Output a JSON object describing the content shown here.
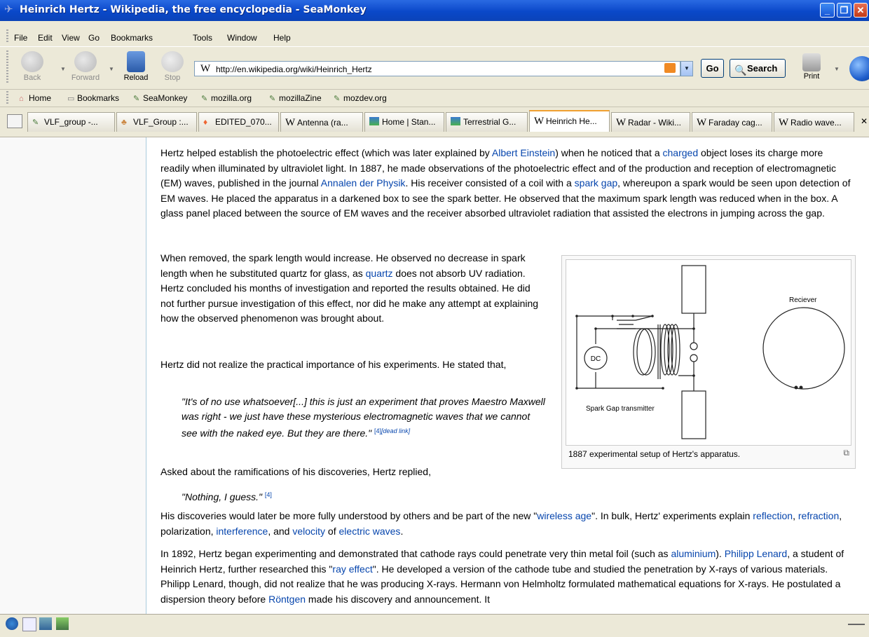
{
  "window": {
    "title": "Heinrich Hertz - Wikipedia, the free encyclopedia - SeaMonkey",
    "min_glyph": "_",
    "max_glyph": "❐",
    "close_glyph": "✕"
  },
  "menu": [
    "File",
    "Edit",
    "View",
    "Go",
    "Bookmarks",
    "Tools",
    "Window",
    "Help"
  ],
  "nav": {
    "back": "Back",
    "forward": "Forward",
    "reload": "Reload",
    "stop": "Stop",
    "url_icon": "W",
    "url": "http://en.wikipedia.org/wiki/Heinrich_Hertz",
    "go": "Go",
    "search": "Search",
    "print": "Print"
  },
  "bookmarks": [
    "Home",
    "Bookmarks",
    "SeaMonkey",
    "mozilla.org",
    "mozillaZine",
    "mozdev.org"
  ],
  "tabs": [
    {
      "label": "VLF_group -...",
      "icon": "pencil-icon"
    },
    {
      "label": "VLF_Group :...",
      "icon": "group-icon"
    },
    {
      "label": "EDITED_070...",
      "icon": "flame-icon"
    },
    {
      "label": "Antenna (ra...",
      "icon": "wikipedia-icon"
    },
    {
      "label": "Home | Stan...",
      "icon": "map-icon"
    },
    {
      "label": "Terrestrial G...",
      "icon": "map-icon"
    },
    {
      "label": "Heinrich He...",
      "icon": "wikipedia-icon",
      "active": true
    },
    {
      "label": "Radar - Wiki...",
      "icon": "wikipedia-icon"
    },
    {
      "label": "Faraday cag...",
      "icon": "wikipedia-icon"
    },
    {
      "label": "Radio wave...",
      "icon": "wikipedia-icon"
    }
  ],
  "article": {
    "p1": {
      "t1": "Hertz helped establish the photoelectric effect (which was later explained by ",
      "l1": "Albert Einstein",
      "t2": ") when he noticed that a ",
      "l2": "charged",
      "t3": " object loses its charge more readily when illuminated by ultraviolet light. In 1887, he made observations of the photoelectric effect and of the production and reception of electromagnetic (EM) waves, published in the journal ",
      "l3": "Annalen der Physik",
      "t4": ". His receiver consisted of a coil with a ",
      "l4": "spark gap",
      "t5": ", whereupon a spark would be seen upon detection of EM waves. He placed the apparatus in a darkened box to see the spark better. He observed that the maximum spark length was reduced when in the box. A glass panel placed between the source of EM waves and the receiver absorbed ultraviolet radiation that assisted the electrons in jumping across the gap."
    },
    "p2": {
      "t1": "When removed, the spark length would increase. He observed no decrease in spark length when he substituted quartz for glass, as ",
      "l1": "quartz",
      "t2": " does not absorb UV radiation. Hertz concluded his months of investigation and reported the results obtained. He did not further pursue investigation of this effect, nor did he make any attempt at explaining how the observed phenomenon was brought about."
    },
    "p3": "Hertz did not realize the practical importance of his experiments. He stated that,",
    "quote1": {
      "text": "\"It's of no use whatsoever[...] this is just an experiment that proves Maestro Maxwell was right - we just have these mysterious electromagnetic waves that we cannot see with the naked eye. But they are there.\"",
      "ref": "[4]",
      "dead": "[dead link]"
    },
    "p4": "Asked about the ramifications of his discoveries, Hertz replied,",
    "quote2": {
      "text": "\"Nothing, I guess.\"",
      "ref": "[4]"
    },
    "p5": {
      "t1": "His discoveries would later be more fully understood by others and be part of the new \"",
      "l1": "wireless age",
      "t2": "\". In bulk, Hertz' experiments explain ",
      "l2": "reflection",
      "t3": ", ",
      "l3": "refraction",
      "t4": ", polarization, ",
      "l4": "interference",
      "t5": ", and ",
      "l5": "velocity",
      "t6": " of ",
      "l6": "electric waves",
      "t7": "."
    },
    "p6": {
      "t1": "In 1892, Hertz began experimenting and demonstrated that cathode rays could penetrate very thin metal foil (such as ",
      "l1": "aluminium",
      "t2": "). ",
      "l2": "Philipp Lenard",
      "t3": ", a student of Heinrich Hertz, further researched this \"",
      "l3": "ray effect",
      "t4": "\". He developed a version of the cathode tube and studied the penetration by X-rays of various materials. Philipp Lenard, though, did not realize that he was producing X-rays. Hermann von Helmholtz formulated mathematical equations for X-rays. He postulated a dispersion theory before ",
      "l4": "Röntgen",
      "t5": " made his discovery and announcement. It"
    }
  },
  "figure": {
    "caption": "1887 experimental setup of Hertz's apparatus.",
    "label_dc": "DC",
    "label_transmitter": "Spark Gap transmitter",
    "label_receiver": "Reciever"
  }
}
